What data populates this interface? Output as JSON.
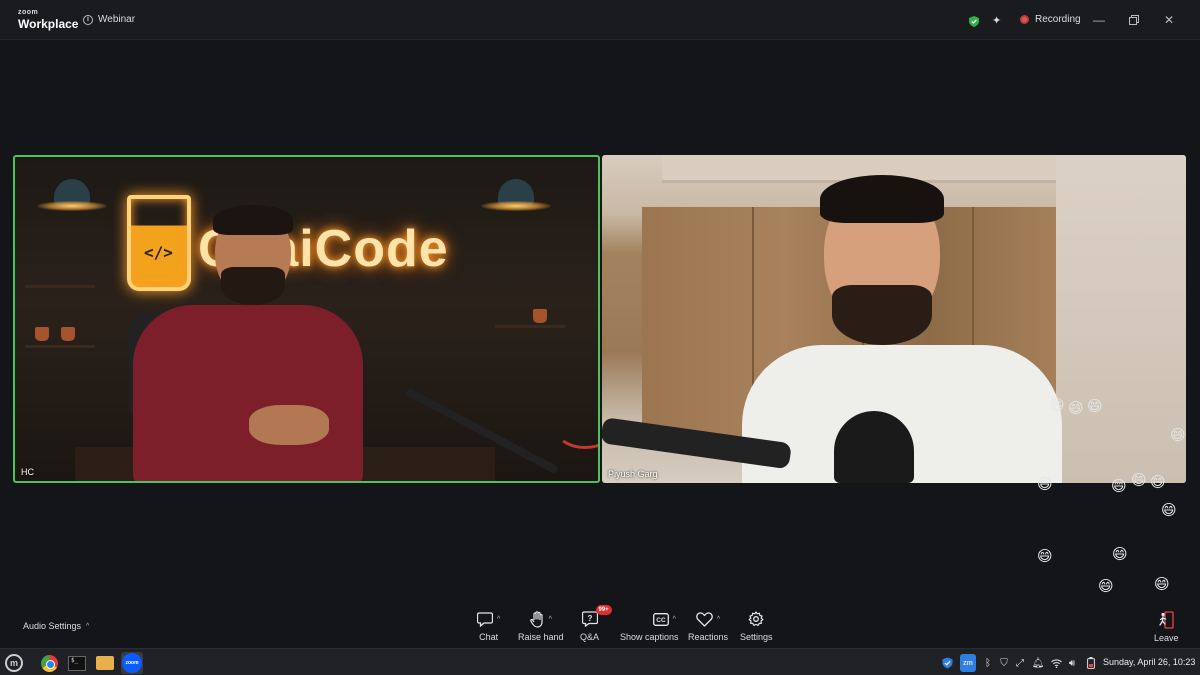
{
  "app": {
    "logo_top": "zoom",
    "logo_main": "Workplace",
    "webinar_label": "Webinar",
    "recording_label": "Recording"
  },
  "tiles": [
    {
      "name": "HC",
      "neon_text": "ChaiCode",
      "code_symbol": "</>"
    },
    {
      "name": "Piyush Garg"
    }
  ],
  "controls": {
    "audio_settings": "Audio Settings",
    "chat": "Chat",
    "raise_hand": "Raise hand",
    "qa": "Q&A",
    "qa_badge": "99+",
    "show_captions": "Show captions",
    "reactions": "Reactions",
    "settings": "Settings",
    "leave": "Leave"
  },
  "reactions": {
    "emoji": "😄",
    "count": 14
  },
  "taskbar": {
    "zoom_icon_label": "zoom",
    "tray_zoom_label": "zm",
    "clock": "Sunday, April 26, 10:23"
  },
  "colors": {
    "active_speaker_border": "#4cc35f",
    "recording_dot": "#e0574f",
    "badge_red": "#e02e2e",
    "zoom_blue": "#0b5cff"
  }
}
